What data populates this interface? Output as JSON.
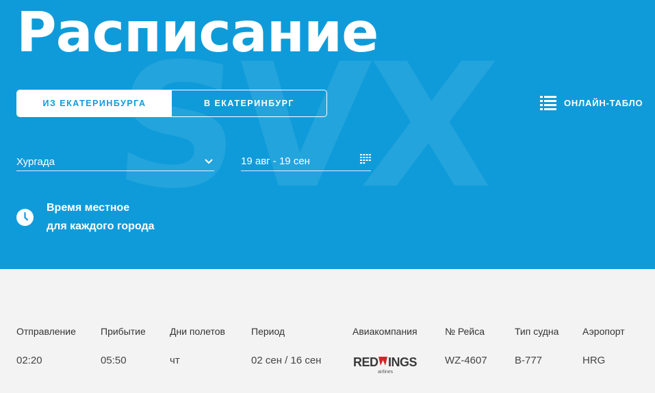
{
  "hero": {
    "title": "Расписание",
    "watermark": "SVX",
    "tabs": [
      {
        "label": "ИЗ ЕКАТЕРИНБУРГА",
        "active": true
      },
      {
        "label": "В ЕКАТЕРИНБУРГ",
        "active": false
      }
    ],
    "online_board": "ОНЛАЙН-ТАБЛО",
    "city_select": "Хургада",
    "date_range": "19 авг - 19 сен",
    "timezone_note_line1": "Время местное",
    "timezone_note_line2": "для каждого города"
  },
  "table": {
    "headers": [
      "Отправление",
      "Прибытие",
      "Дни полетов",
      "Период",
      "Авиакомпания",
      "№ Рейса",
      "Тип судна",
      "Аэропорт"
    ],
    "rows": [
      {
        "departure": "02:20",
        "arrival": "05:50",
        "days": "чт",
        "period": "02 сен / 16 сен",
        "airline_logo": "REDWINGS",
        "airline_sub": "airlines",
        "flight": "WZ-4607",
        "aircraft": "B-777",
        "airport": "HRG"
      }
    ]
  },
  "colors": {
    "primary": "#0f9bd9",
    "background": "#f3f3f3",
    "logo_red": "#d8232a"
  },
  "icons": [
    "list-icon",
    "chevron-down-icon",
    "calendar-grid-icon",
    "clock-icon"
  ]
}
